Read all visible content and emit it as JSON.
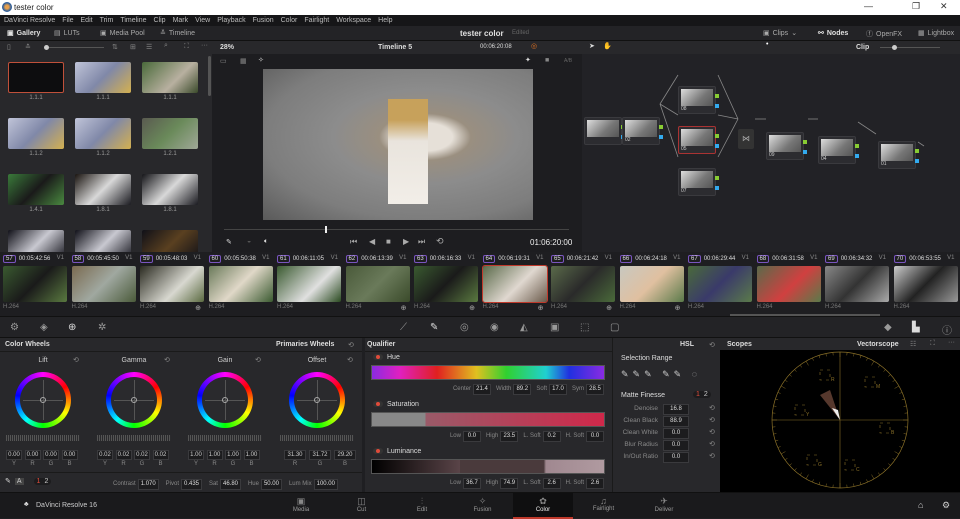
{
  "window": {
    "title": "tester color",
    "minimize": "—",
    "maximize": "❐",
    "close": "✕"
  },
  "menu": [
    "DaVinci Resolve",
    "File",
    "Edit",
    "Trim",
    "Timeline",
    "Clip",
    "Mark",
    "View",
    "Playback",
    "Fusion",
    "Color",
    "Fairlight",
    "Workspace",
    "Help"
  ],
  "toolbar": {
    "gallery": "Gallery",
    "luts": "LUTs",
    "media_pool": "Media Pool",
    "timeline": "Timeline",
    "project": "tester color",
    "edited": "Edited",
    "clips": "Clips",
    "nodes": "Nodes",
    "openfx": "OpenFX",
    "lightbox": "Lightbox"
  },
  "viewer": {
    "zoom": "28%",
    "timeline_name": "Timeline 5",
    "timecode_top": "00:06:20:08",
    "timecode": "01:06:20:00",
    "ab": "A/B"
  },
  "nodes_header": {
    "mode": "Clip"
  },
  "gallery": {
    "stills": [
      "1.1.1",
      "1.1.1",
      "1.1.1",
      "1.1.2",
      "1.1.2",
      "1.2.1",
      "1.4.1",
      "1.8.1",
      "1.8.1",
      "",
      "",
      ""
    ]
  },
  "node_labels": [
    "",
    "02",
    "08",
    "05",
    "07",
    "09",
    "04",
    "01"
  ],
  "clips": [
    {
      "num": "57",
      "tc": "00:05:42:56",
      "track": "V1",
      "codec": "H.264"
    },
    {
      "num": "58",
      "tc": "00:05:45:50",
      "track": "V1",
      "codec": "H.264"
    },
    {
      "num": "59",
      "tc": "00:05:48:03",
      "track": "V1",
      "codec": "H.264"
    },
    {
      "num": "60",
      "tc": "00:05:50:38",
      "track": "V1",
      "codec": "H.264"
    },
    {
      "num": "61",
      "tc": "00:06:11:05",
      "track": "V1",
      "codec": "H.264"
    },
    {
      "num": "62",
      "tc": "00:06:13:39",
      "track": "V1",
      "codec": "H.264"
    },
    {
      "num": "63",
      "tc": "00:06:16:33",
      "track": "V1",
      "codec": "H.264"
    },
    {
      "num": "64",
      "tc": "00:06:19:31",
      "track": "V1",
      "codec": "H.264"
    },
    {
      "num": "65",
      "tc": "00:06:21:42",
      "track": "V1",
      "codec": "H.264"
    },
    {
      "num": "66",
      "tc": "00:06:24:18",
      "track": "V1",
      "codec": "H.264"
    },
    {
      "num": "67",
      "tc": "00:06:29:44",
      "track": "V1",
      "codec": "H.264"
    },
    {
      "num": "68",
      "tc": "00:06:31:58",
      "track": "V1",
      "codec": "H.264"
    },
    {
      "num": "69",
      "tc": "00:06:34:32",
      "track": "V1",
      "codec": "H.264"
    },
    {
      "num": "70",
      "tc": "00:06:53:55",
      "track": "V1",
      "codec": "H.264"
    }
  ],
  "color_wheels": {
    "title": "Color Wheels",
    "mode": "Primaries Wheels",
    "wheels": [
      {
        "name": "Lift",
        "values": [
          "0.00",
          "0.00",
          "0.00",
          "0.00"
        ],
        "labels": [
          "Y",
          "R",
          "G",
          "B"
        ]
      },
      {
        "name": "Gamma",
        "values": [
          "0.02",
          "0.02",
          "0.02",
          "0.02"
        ],
        "labels": [
          "Y",
          "R",
          "G",
          "B"
        ]
      },
      {
        "name": "Gain",
        "values": [
          "1.00",
          "1.00",
          "1.00",
          "1.00"
        ],
        "labels": [
          "Y",
          "R",
          "G",
          "B"
        ]
      },
      {
        "name": "Offset",
        "values": [
          "31.30",
          "31.72",
          "29.20"
        ],
        "labels": [
          "R",
          "G",
          "B"
        ]
      }
    ],
    "page1": "1",
    "page2": "2",
    "contrast_label": "Contrast",
    "contrast": "1.070",
    "pivot_label": "Pivot",
    "pivot": "0.435",
    "sat_label": "Sat",
    "sat": "46.80",
    "hue_label": "Hue",
    "hue": "50.00",
    "lummix_label": "Lum Mix",
    "lummix": "100.00"
  },
  "qualifier": {
    "title": "Qualifier",
    "mode": "HSL",
    "hue": {
      "label": "Hue",
      "center_label": "Center",
      "center": "21.4",
      "width_label": "Width",
      "width": "89.2",
      "soft_label": "Soft",
      "soft": "17.0",
      "sym_label": "Sym",
      "sym": "28.5"
    },
    "saturation": {
      "label": "Saturation",
      "low_label": "Low",
      "low": "0.0",
      "high_label": "High",
      "high": "23.5",
      "lsoft_label": "L. Soft",
      "lsoft": "0.2",
      "hsoft_label": "H. Soft",
      "hsoft": "0.0"
    },
    "luminance": {
      "label": "Luminance",
      "low_label": "Low",
      "low": "36.7",
      "high_label": "High",
      "high": "74.9",
      "lsoft_label": "L. Soft",
      "lsoft": "2.6",
      "hsoft_label": "H. Soft",
      "hsoft": "2.6"
    }
  },
  "selection": {
    "title": "Selection Range",
    "matte": "Matte Finesse",
    "p1": "1",
    "p2": "2",
    "rows": [
      {
        "label": "Denoise",
        "value": "16.8"
      },
      {
        "label": "Clean Black",
        "value": "88.9"
      },
      {
        "label": "Clean White",
        "value": "0.0"
      },
      {
        "label": "Blur Radius",
        "value": "0.0"
      },
      {
        "label": "In/Out Ratio",
        "value": "0.0"
      }
    ]
  },
  "scopes": {
    "title": "Scopes",
    "type": "Vectorscope",
    "targets": [
      "R",
      "M",
      "Y",
      "B",
      "G",
      "C"
    ]
  },
  "bottom": {
    "app": "DaVinci Resolve 16",
    "pages": [
      "Media",
      "Cut",
      "Edit",
      "Fusion",
      "Color",
      "Fairlight",
      "Deliver"
    ],
    "active": "Color"
  }
}
